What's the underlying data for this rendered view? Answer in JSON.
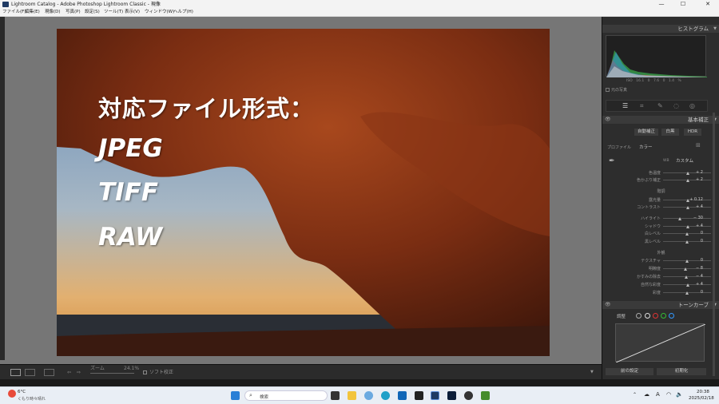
{
  "window": {
    "title": "Lightroom Catalog - Adobe Photoshop Lightroom Classic - 現像"
  },
  "menu": [
    "ファイル(F)",
    "編集(E)",
    "現像(D)",
    "写真(P)",
    "設定(S)",
    "ツール(T)",
    "表示(V)",
    "ウィンドウ(W)",
    "ヘルプ(H)"
  ],
  "overlay": {
    "title": "対応ファイル形式：",
    "formats": [
      "JPEG",
      "TIFF",
      "RAW"
    ]
  },
  "histogram": {
    "panel_title": "ヒストグラム",
    "readout": [
      "ISO",
      "16.1",
      "0",
      "7.6",
      "0",
      "1.4",
      "%"
    ],
    "original_photo": "元の写真"
  },
  "basic": {
    "panel_title": "基本補正",
    "auto": "自動補正",
    "bw": "白黒",
    "hdr": "HDR",
    "profile_label": "プロファイル",
    "profile_value": "カラー",
    "wb_label": "WB",
    "wb_value": "カスタム",
    "sliders_wb": [
      {
        "label": "色温度",
        "value": "+ 2",
        "pos": 0.52
      },
      {
        "label": "色かぶり補正",
        "value": "+ 2",
        "pos": 0.52
      }
    ],
    "tone_section": "階調",
    "sliders_tone": [
      {
        "label": "露光量",
        "value": "+ 0.12",
        "pos": 0.52
      },
      {
        "label": "コントラスト",
        "value": "+ 4",
        "pos": 0.52
      }
    ],
    "sliders_tone2": [
      {
        "label": "ハイライト",
        "value": "− 30",
        "pos": 0.35
      },
      {
        "label": "シャドウ",
        "value": "+ 4",
        "pos": 0.52
      },
      {
        "label": "白レベル",
        "value": "0",
        "pos": 0.5
      },
      {
        "label": "黒レベル",
        "value": "0",
        "pos": 0.5
      }
    ],
    "presence_section": "外観",
    "sliders_presence": [
      {
        "label": "テクスチャ",
        "value": "0",
        "pos": 0.5
      },
      {
        "label": "明瞭度",
        "value": "− 8",
        "pos": 0.46
      },
      {
        "label": "かすみの除去",
        "value": "− 4",
        "pos": 0.48
      },
      {
        "label": "自然な彩度",
        "value": "+ 4",
        "pos": 0.52
      },
      {
        "label": "彩度",
        "value": "0",
        "pos": 0.5
      }
    ]
  },
  "tone_curve": {
    "panel_title": "トーンカーブ",
    "adjust": "調整"
  },
  "bottom_buttons": {
    "previous": "前の設定",
    "reset": "初期化"
  },
  "toolbar": {
    "zoom_label": "ズーム",
    "zoom_value": "24.1%",
    "soft_proof": "ソフト校正"
  },
  "taskbar": {
    "weather_temp": "6°C",
    "weather_desc": "くもり時々晴れ",
    "search_placeholder": "検索",
    "time": "20:38",
    "date": "2025/02/18",
    "ime": "A"
  },
  "colors": {
    "accent": "#3f7fd1",
    "panel": "#2d2d2d",
    "work": "#767676"
  }
}
